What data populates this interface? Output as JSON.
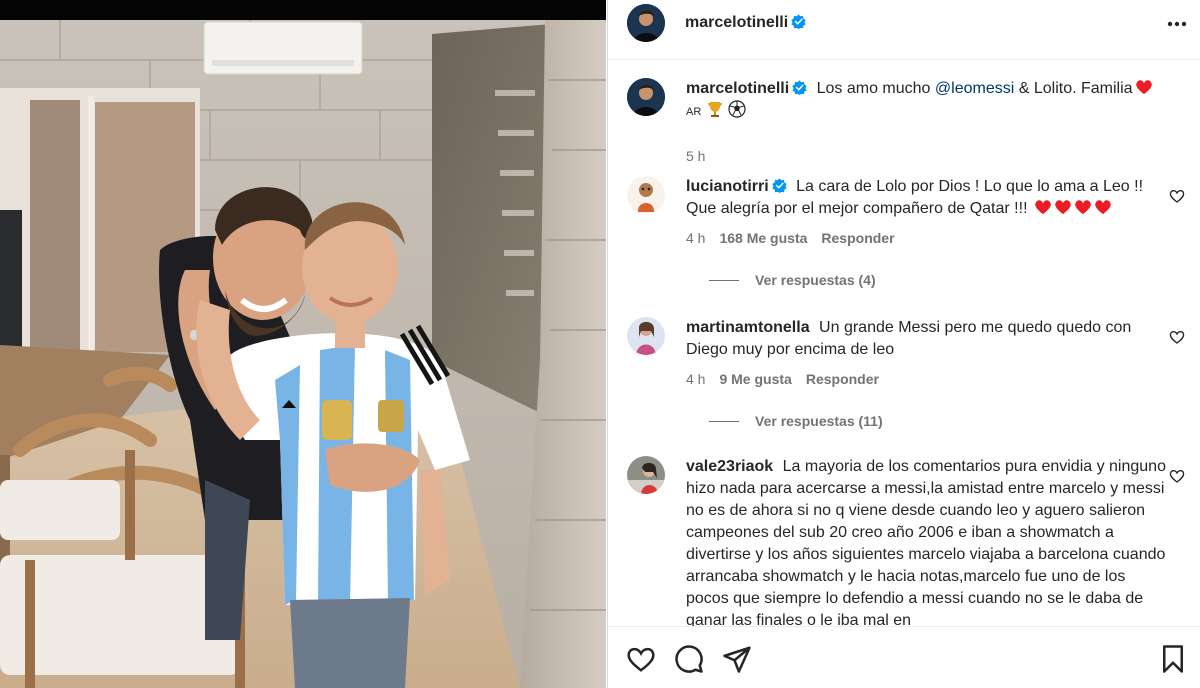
{
  "post": {
    "author": "marcelotinelli",
    "caption_text": "Los amo mucho",
    "caption_mention": "@leomessi",
    "caption_rest": "& Lolito. Familia",
    "caption_suffix": "AR",
    "time": "5 h",
    "verified": true
  },
  "comments": [
    {
      "user": "lucianotirri",
      "verified": true,
      "text": "La cara de Lolo por Dios ! Lo que lo ama a Leo !! Que alegría por el mejor compañero de Qatar !!!",
      "time": "4 h",
      "likes": "168 Me gusta",
      "reply": "Responder",
      "replies": "Ver respuestas (4)"
    },
    {
      "user": "martinamtonella",
      "verified": false,
      "text": "Un grande Messi pero me quedo quedo con Diego muy por encima de leo",
      "time": "4 h",
      "likes": "9 Me gusta",
      "reply": "Responder",
      "replies": "Ver respuestas (11)"
    },
    {
      "user": "vale23riaok",
      "verified": false,
      "text": "La mayoria de los comentarios pura envidia y ninguno hizo nada para acercarse a messi,la amistad entre marcelo y messi no es de ahora si no q viene desde cuando leo y aguero salieron campeones del sub 20 creo año 2006 e iban a showmatch a divertirse y los años siguientes marcelo viajaba a barcelona cuando arrancaba showmatch y le hacia notas,marcelo fue uno de los pocos que siempre lo defendio a messi cuando no se le daba de ganar las finales o le iba mal en"
    }
  ],
  "icons": {
    "more": "more-horizontal-icon",
    "like": "heart-icon",
    "comment": "comment-bubble-icon",
    "share": "paper-plane-icon",
    "save": "bookmark-icon"
  },
  "colors": {
    "verified": "#0095f6",
    "heart_red": "#ed1c24",
    "mention": "#00376b",
    "secondary_text": "#737373"
  }
}
